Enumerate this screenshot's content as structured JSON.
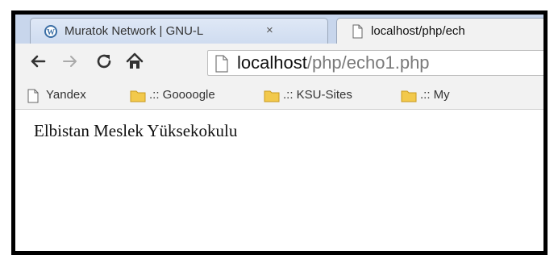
{
  "tabs": [
    {
      "title": "Muratok Network | GNU-L",
      "close": "×",
      "favicon": "wordpress-icon",
      "active": false
    },
    {
      "title": "localhost/php/ech",
      "favicon": "page-icon",
      "active": true
    }
  ],
  "toolbar": {
    "back": "back-arrow-icon",
    "forward": "forward-arrow-icon",
    "reload": "reload-icon",
    "home": "home-icon"
  },
  "omnibox": {
    "host": "localhost",
    "path": "/php/echo1.php"
  },
  "bookmarks": [
    {
      "label": "Yandex",
      "icon": "page-icon"
    },
    {
      "label": ".:: Goooogle",
      "icon": "folder-icon"
    },
    {
      "label": ".:: KSU-Sites",
      "icon": "folder-icon"
    },
    {
      "label": ".:: My",
      "icon": "folder-icon"
    }
  ],
  "page": {
    "body_text": "Elbistan Meslek Yüksekokulu"
  },
  "colors": {
    "tabstrip": "#c8d6ec",
    "toolbar": "#f2f2f2",
    "folder": "#f2c94c",
    "wordpress": "#3a6ea5"
  }
}
